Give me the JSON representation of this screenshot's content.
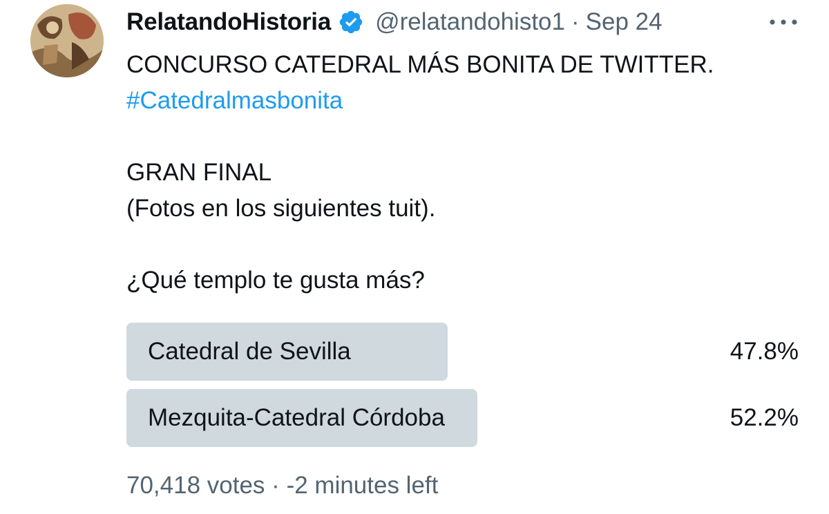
{
  "author": {
    "display_name": "RelatandoHistoria",
    "handle": "@relatandohisto1",
    "separator": "·",
    "date": "Sep 24"
  },
  "tweet": {
    "line1": "CONCURSO CATEDRAL MÁS BONITA DE TWITTER.",
    "hashtag": "#Catedralmasbonita",
    "line3": "GRAN FINAL",
    "line4": "(Fotos en los siguientes tuit).",
    "question": "¿Qué templo te gusta más?"
  },
  "poll": {
    "options": [
      {
        "label": "Catedral de Sevilla",
        "percent_text": "47.8%",
        "percent": 47.8
      },
      {
        "label": "Mezquita-Catedral Córdoba",
        "percent_text": "52.2%",
        "percent": 52.2
      }
    ],
    "votes": "70,418 votes",
    "separator": "·",
    "time_left": "-2 minutes left"
  },
  "colors": {
    "text": "#0f1419",
    "secondary": "#536471",
    "link": "#1d9bf0",
    "poll_bar": "#cfd9de",
    "verified": "#1d9bf0"
  },
  "icons": {
    "verified": "verified-badge-icon",
    "more": "more-options-icon"
  }
}
